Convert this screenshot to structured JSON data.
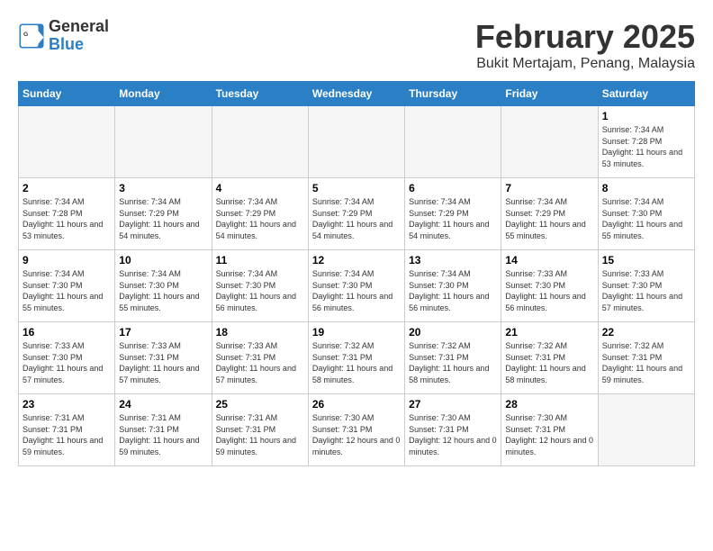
{
  "header": {
    "logo_general": "General",
    "logo_blue": "Blue",
    "month_title": "February 2025",
    "location": "Bukit Mertajam, Penang, Malaysia"
  },
  "weekdays": [
    "Sunday",
    "Monday",
    "Tuesday",
    "Wednesday",
    "Thursday",
    "Friday",
    "Saturday"
  ],
  "weeks": [
    [
      {
        "day": "",
        "empty": true
      },
      {
        "day": "",
        "empty": true
      },
      {
        "day": "",
        "empty": true
      },
      {
        "day": "",
        "empty": true
      },
      {
        "day": "",
        "empty": true
      },
      {
        "day": "",
        "empty": true
      },
      {
        "day": "1",
        "sunrise": "7:34 AM",
        "sunset": "7:28 PM",
        "daylight": "11 hours and 53 minutes."
      }
    ],
    [
      {
        "day": "2",
        "sunrise": "7:34 AM",
        "sunset": "7:28 PM",
        "daylight": "11 hours and 53 minutes."
      },
      {
        "day": "3",
        "sunrise": "7:34 AM",
        "sunset": "7:29 PM",
        "daylight": "11 hours and 54 minutes."
      },
      {
        "day": "4",
        "sunrise": "7:34 AM",
        "sunset": "7:29 PM",
        "daylight": "11 hours and 54 minutes."
      },
      {
        "day": "5",
        "sunrise": "7:34 AM",
        "sunset": "7:29 PM",
        "daylight": "11 hours and 54 minutes."
      },
      {
        "day": "6",
        "sunrise": "7:34 AM",
        "sunset": "7:29 PM",
        "daylight": "11 hours and 54 minutes."
      },
      {
        "day": "7",
        "sunrise": "7:34 AM",
        "sunset": "7:29 PM",
        "daylight": "11 hours and 55 minutes."
      },
      {
        "day": "8",
        "sunrise": "7:34 AM",
        "sunset": "7:30 PM",
        "daylight": "11 hours and 55 minutes."
      }
    ],
    [
      {
        "day": "9",
        "sunrise": "7:34 AM",
        "sunset": "7:30 PM",
        "daylight": "11 hours and 55 minutes."
      },
      {
        "day": "10",
        "sunrise": "7:34 AM",
        "sunset": "7:30 PM",
        "daylight": "11 hours and 55 minutes."
      },
      {
        "day": "11",
        "sunrise": "7:34 AM",
        "sunset": "7:30 PM",
        "daylight": "11 hours and 56 minutes."
      },
      {
        "day": "12",
        "sunrise": "7:34 AM",
        "sunset": "7:30 PM",
        "daylight": "11 hours and 56 minutes."
      },
      {
        "day": "13",
        "sunrise": "7:34 AM",
        "sunset": "7:30 PM",
        "daylight": "11 hours and 56 minutes."
      },
      {
        "day": "14",
        "sunrise": "7:33 AM",
        "sunset": "7:30 PM",
        "daylight": "11 hours and 56 minutes."
      },
      {
        "day": "15",
        "sunrise": "7:33 AM",
        "sunset": "7:30 PM",
        "daylight": "11 hours and 57 minutes."
      }
    ],
    [
      {
        "day": "16",
        "sunrise": "7:33 AM",
        "sunset": "7:30 PM",
        "daylight": "11 hours and 57 minutes."
      },
      {
        "day": "17",
        "sunrise": "7:33 AM",
        "sunset": "7:31 PM",
        "daylight": "11 hours and 57 minutes."
      },
      {
        "day": "18",
        "sunrise": "7:33 AM",
        "sunset": "7:31 PM",
        "daylight": "11 hours and 57 minutes."
      },
      {
        "day": "19",
        "sunrise": "7:32 AM",
        "sunset": "7:31 PM",
        "daylight": "11 hours and 58 minutes."
      },
      {
        "day": "20",
        "sunrise": "7:32 AM",
        "sunset": "7:31 PM",
        "daylight": "11 hours and 58 minutes."
      },
      {
        "day": "21",
        "sunrise": "7:32 AM",
        "sunset": "7:31 PM",
        "daylight": "11 hours and 58 minutes."
      },
      {
        "day": "22",
        "sunrise": "7:32 AM",
        "sunset": "7:31 PM",
        "daylight": "11 hours and 59 minutes."
      }
    ],
    [
      {
        "day": "23",
        "sunrise": "7:31 AM",
        "sunset": "7:31 PM",
        "daylight": "11 hours and 59 minutes."
      },
      {
        "day": "24",
        "sunrise": "7:31 AM",
        "sunset": "7:31 PM",
        "daylight": "11 hours and 59 minutes."
      },
      {
        "day": "25",
        "sunrise": "7:31 AM",
        "sunset": "7:31 PM",
        "daylight": "11 hours and 59 minutes."
      },
      {
        "day": "26",
        "sunrise": "7:30 AM",
        "sunset": "7:31 PM",
        "daylight": "12 hours and 0 minutes."
      },
      {
        "day": "27",
        "sunrise": "7:30 AM",
        "sunset": "7:31 PM",
        "daylight": "12 hours and 0 minutes."
      },
      {
        "day": "28",
        "sunrise": "7:30 AM",
        "sunset": "7:31 PM",
        "daylight": "12 hours and 0 minutes."
      },
      {
        "day": "",
        "empty": true
      }
    ]
  ]
}
